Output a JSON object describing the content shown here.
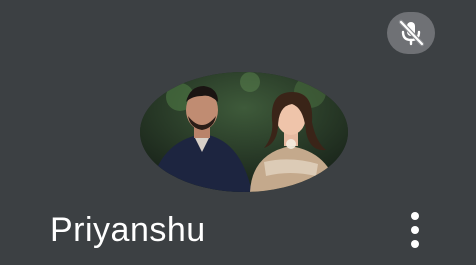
{
  "participant": {
    "name": "Priyanshu",
    "mic_state": "muted",
    "mic_icon": "mic-off-icon",
    "menu_icon": "more-vert-icon"
  },
  "colors": {
    "tile_background": "#3c4043",
    "name_text": "#ffffff",
    "mute_badge": "#808286"
  }
}
